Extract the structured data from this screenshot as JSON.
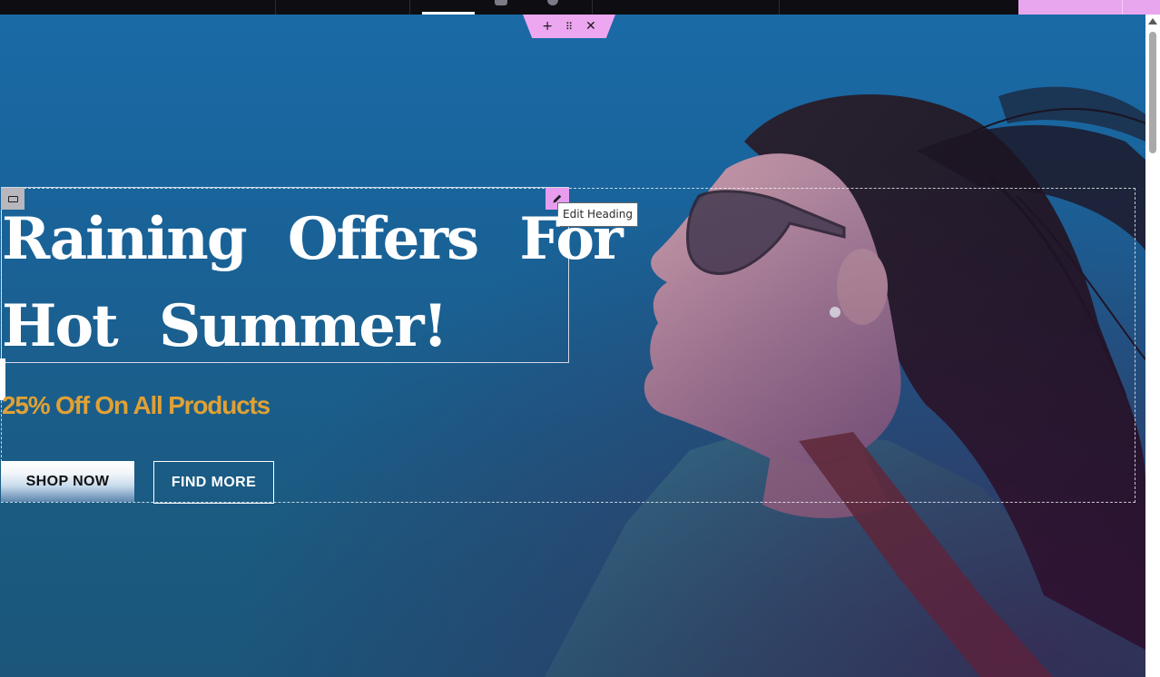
{
  "editor": {
    "section_handle": {
      "add_icon": "plus-icon",
      "drag_icon": "drag-grid-icon",
      "close_icon": "close-icon",
      "add_glyph": "+",
      "drag_glyph": "⠿",
      "close_glyph": "✕"
    },
    "widget_icon": "rectangle-icon",
    "edit_icon": "pencil-icon",
    "tooltip": "Edit Heading"
  },
  "hero": {
    "heading_line1": "Raining Offers For",
    "heading_line2": "Hot Summer!",
    "subheading": "25% Off On All Products",
    "primary_button": "SHOP NOW",
    "secondary_button": "FIND MORE"
  },
  "colors": {
    "accent_pink": "#e8a6ef",
    "subheading_gold": "#e0a135",
    "hero_blue": "#1a6aa6"
  }
}
